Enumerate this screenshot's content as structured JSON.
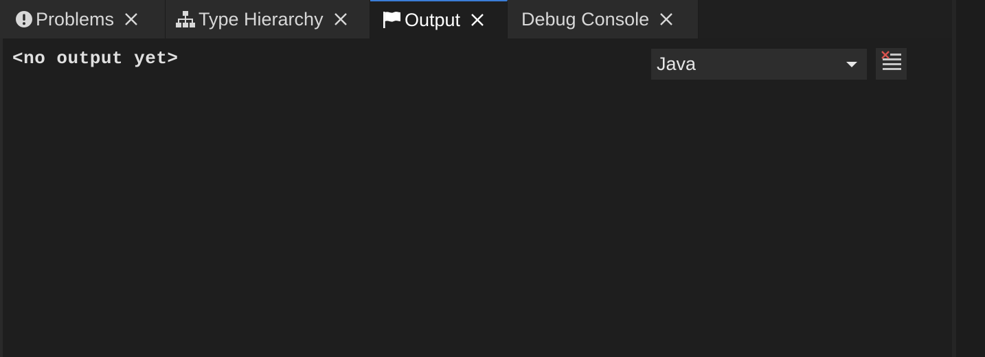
{
  "tabs": [
    {
      "label": "Problems",
      "icon": "alert-circle-icon",
      "active": false
    },
    {
      "label": "Type Hierarchy",
      "icon": "hierarchy-icon",
      "active": false
    },
    {
      "label": "Output",
      "icon": "flag-icon",
      "active": true
    },
    {
      "label": "Debug Console",
      "icon": "",
      "active": false
    }
  ],
  "output": {
    "text": "<no output yet>",
    "channel_selected": "Java",
    "clear_icon": "clear-output-icon"
  },
  "colors": {
    "active_tab_border": "#3b7dd8",
    "clear_icon_x": "#d9534f"
  }
}
